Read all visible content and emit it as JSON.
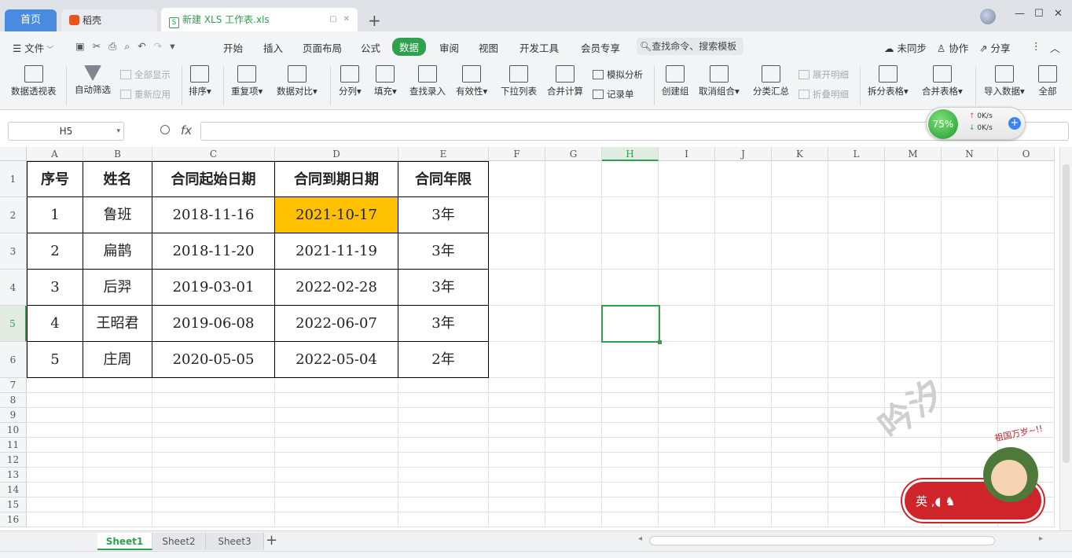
{
  "tabs": {
    "home": "首页",
    "daoke": "稻壳",
    "doc": "新建 XLS 工作表.xls"
  },
  "menubar": {
    "file": "文件",
    "items": [
      "开始",
      "插入",
      "页面布局",
      "公式",
      "数据",
      "审阅",
      "视图",
      "开发工具",
      "会员专享"
    ],
    "active": "数据",
    "search": "查找命令、搜索模板",
    "unsync": "未同步",
    "collab": "协作",
    "share": "分享"
  },
  "ribbon": {
    "pivot": "数据透视表",
    "auto_filter": "自动筛选",
    "show_all": "全部显示",
    "reapply": "重新应用",
    "sort": "排序",
    "duplicates": "重复项",
    "compare": "数据对比",
    "split": "分列",
    "fill": "填充",
    "find_entry": "查找录入",
    "validity": "有效性",
    "dropdown": "下拉列表",
    "consolidate": "合并计算",
    "whatif": "模拟分析",
    "record": "记录单",
    "group": "创建组",
    "ungroup": "取消组合",
    "subtotal": "分类汇总",
    "expand": "展开明细",
    "collapse": "折叠明细",
    "split_table": "拆分表格",
    "merge_table": "合并表格",
    "import": "导入数据",
    "all": "全部"
  },
  "formula_bar": {
    "name_box": "H5",
    "fx": "fx",
    "value": ""
  },
  "net_widget": {
    "percent": "75%",
    "upload": "0K/s",
    "download": "0K/s"
  },
  "columns": [
    "A",
    "B",
    "C",
    "D",
    "E",
    "F",
    "G",
    "H",
    "I",
    "J",
    "K",
    "L",
    "M",
    "N",
    "O"
  ],
  "rows": [
    "1",
    "2",
    "3",
    "4",
    "5",
    "6",
    "7",
    "8",
    "9",
    "10",
    "11",
    "12",
    "13",
    "14",
    "15",
    "16"
  ],
  "selected_cell": "H5",
  "table": {
    "headers": [
      "序号",
      "姓名",
      "合同起始日期",
      "合同到期日期",
      "合同年限"
    ],
    "rows": [
      [
        "1",
        "鲁班",
        "2018-11-16",
        "2021-10-17",
        "3年"
      ],
      [
        "2",
        "扁鹊",
        "2018-11-20",
        "2021-11-19",
        "3年"
      ],
      [
        "3",
        "后羿",
        "2019-03-01",
        "2022-02-28",
        "3年"
      ],
      [
        "4",
        "王昭君",
        "2019-06-08",
        "2022-06-07",
        "3年"
      ],
      [
        "5",
        "庄周",
        "2020-05-05",
        "2022-05-04",
        "2年"
      ]
    ],
    "highlight_color": "#ffc000"
  },
  "watermark": "吟汐",
  "sticker": {
    "caption": "祖国万岁~!!",
    "label": "英"
  },
  "sheets": [
    "Sheet1",
    "Sheet2",
    "Sheet3"
  ],
  "active_sheet": "Sheet1",
  "accent_color": "#2ea04e"
}
